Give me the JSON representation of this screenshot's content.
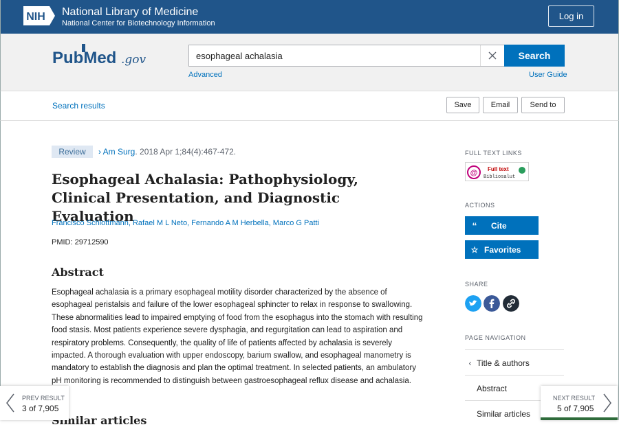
{
  "header": {
    "nih_badge": "NIH",
    "org_name": "National Library of Medicine",
    "org_sub": "National Center for Biotechnology Information",
    "login_label": "Log in"
  },
  "search": {
    "logo_pub": "Pub",
    "logo_med": "Med",
    "logo_gov": ".gov",
    "query": "esophageal achalasia",
    "search_label": "Search",
    "advanced_label": "Advanced",
    "user_guide_label": "User Guide"
  },
  "toolbar": {
    "results_link": "Search results",
    "save_label": "Save",
    "email_label": "Email",
    "send_to_label": "Send to"
  },
  "article": {
    "type_badge": "Review",
    "journal": "Am Surg",
    "citation": ". 2018 Apr 1;84(4):467-472.",
    "title": "Esophageal Achalasia: Pathophysiology, Clinical Presentation, and Diagnostic Evaluation",
    "authors": "Francisco Schlottmann, Rafael M L Neto, Fernando A M Herbella, Marco G Patti",
    "pmid": "PMID: 29712590",
    "abstract_heading": "Abstract",
    "abstract_text": "Esophageal achalasia is a primary esophageal motility disorder characterized by the absence of esophageal peristalsis and failure of the lower esophageal sphincter to relax in response to swallowing. These abnormalities lead to impaired emptying of food from the esophagus into the stomach with resulting food stasis. Most patients experience severe dysphagia, and regurgitation can lead to aspiration and respiratory problems. Consequently, the quality of life of patients affected by achalasia is severely impacted. A thorough evaluation with upper endoscopy, barium swallow, and esophageal manometry is mandatory to establish the diagnosis and plan the optimal treatment. In selected patients, an ambulatory pH monitoring is recommended to distinguish between gastroesophageal reflux disease and achalasia.",
    "next_heading_partial": "Similar articles"
  },
  "sidebar": {
    "full_text_label": "FULL TEXT LINKS",
    "full_text_provider_top": "Full text",
    "full_text_provider_bottom": "Bibliosalut",
    "actions_label": "ACTIONS",
    "cite_label": "Cite",
    "favorites_label": "Favorites",
    "share_label": "SHARE",
    "page_nav_label": "PAGE NAVIGATION",
    "nav_items": [
      "Title & authors",
      "Abstract",
      "Similar articles"
    ]
  },
  "pager": {
    "prev_label": "PREV RESULT",
    "prev_count": "3 of 7,905",
    "next_label": "NEXT RESULT",
    "next_count": "5 of 7,905"
  },
  "colors": {
    "nih_blue": "#20558a",
    "link_blue": "#0071bc",
    "twitter": "#1da1f2",
    "facebook": "#3b5998",
    "permalink": "#222c37"
  }
}
